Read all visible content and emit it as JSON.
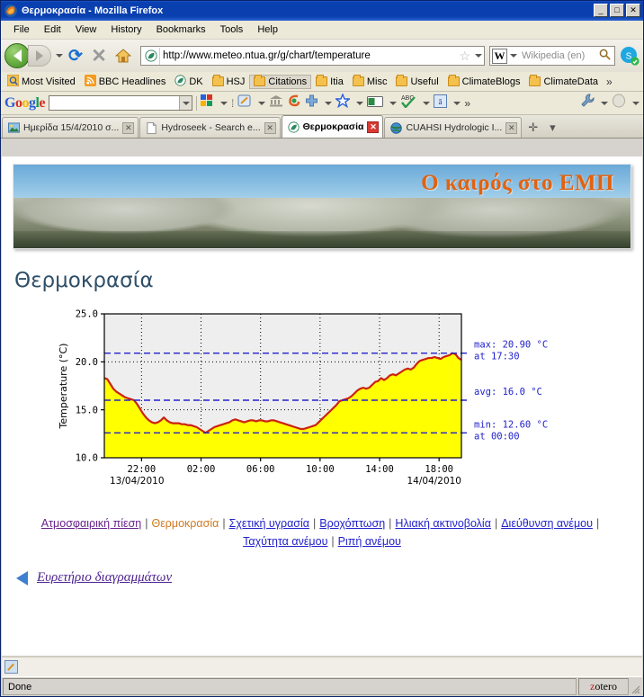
{
  "window": {
    "title": "Θερμοκρασία - Mozilla Firefox",
    "minimize_label": "_",
    "maximize_label": "□",
    "close_label": "✕"
  },
  "menubar": {
    "items": [
      {
        "label": "File"
      },
      {
        "label": "Edit"
      },
      {
        "label": "View"
      },
      {
        "label": "History"
      },
      {
        "label": "Bookmarks"
      },
      {
        "label": "Tools"
      },
      {
        "label": "Help"
      }
    ]
  },
  "navbar": {
    "back_title": "Back",
    "forward_title": "Forward",
    "reload_glyph": "⟳",
    "stop_glyph": "✕",
    "url": "http://www.meteo.ntua.gr/g/chart/temperature",
    "star_glyph": "☆",
    "search_engine": "Wikipedia (en)",
    "search_placeholder": "Wikipedia (en)",
    "search_logo": "W",
    "magnifier_glyph": "🔍"
  },
  "bookmarks": {
    "items": [
      {
        "label": "Most Visited",
        "icon": "globe-icon"
      },
      {
        "label": "BBC Headlines",
        "icon": "rss-icon"
      },
      {
        "label": "DK",
        "icon": "firefox-icon"
      },
      {
        "label": "HSJ",
        "icon": "folder-icon"
      },
      {
        "label": "Citations",
        "icon": "folder-icon"
      },
      {
        "label": "Itia",
        "icon": "folder-icon"
      },
      {
        "label": "Misc",
        "icon": "folder-icon"
      },
      {
        "label": "Useful",
        "icon": "folder-icon"
      },
      {
        "label": "ClimateBlogs",
        "icon": "folder-icon"
      },
      {
        "label": "ClimateData",
        "icon": "folder-icon"
      }
    ],
    "overflow_glyph": "»"
  },
  "google_toolbar": {
    "logo": "Google",
    "search_value": "",
    "overflow_glyph": "»",
    "icons": [
      "google-apps-icon",
      "divider-icon",
      "notes-icon",
      "bank-icon",
      "autolink-icon",
      "plus-icon",
      "bookmark-star-icon",
      "highlight-icon",
      "spellcheck-icon",
      "translate-icon",
      "more-icon",
      "wrench-icon",
      "account-icon"
    ]
  },
  "tabs": [
    {
      "label": "Ημερίδα 15/4/2010 σ...",
      "icon": "image-icon",
      "active": false,
      "close": "✕"
    },
    {
      "label": "Hydroseek - Search e...",
      "icon": "page-icon",
      "active": false,
      "close": "✕"
    },
    {
      "label": "Θερμοκρασία",
      "icon": "firefox-icon",
      "active": true,
      "close": "✕"
    },
    {
      "label": "CUAHSI Hydrologic I...",
      "icon": "globe-icon",
      "active": false,
      "close": "✕"
    }
  ],
  "newtab_glyph": "✛",
  "tablist_glyph": "▾",
  "page": {
    "banner_text": "Ο καιρός στο ΕΜΠ",
    "heading": "Θερμοκρασία",
    "links": [
      {
        "label": "Ατμοσφαιρική πίεση",
        "state": "visited"
      },
      {
        "label": "Θερμοκρασία",
        "state": "current"
      },
      {
        "label": "Σχετική υγρασία",
        "state": "link"
      },
      {
        "label": "Βροχόπτωση",
        "state": "link"
      },
      {
        "label": "Ηλιακή ακτινοβολία",
        "state": "link"
      },
      {
        "label": "Διεύθυνση ανέμου",
        "state": "link"
      },
      {
        "label": "Ταχύτητα ανέμου",
        "state": "link"
      },
      {
        "label": "Ριπή ανέμου",
        "state": "link"
      }
    ],
    "separator": "|",
    "index_link": "Ευρετήριο διαγραμμάτων"
  },
  "statusbar": {
    "status": "Done",
    "zotero_z": "z",
    "zotero_rest": "otero"
  },
  "chart_data": {
    "type": "area",
    "title": "",
    "xlabel": "",
    "ylabel": "Temperature (°C)",
    "ylim": [
      10.0,
      25.0
    ],
    "yticks": [
      "10.0",
      "15.0",
      "20.0",
      "25.0"
    ],
    "ytick_values": [
      10.0,
      15.0,
      20.0,
      25.0
    ],
    "xticks": [
      "22:00",
      "02:00",
      "06:00",
      "10:00",
      "14:00",
      "18:00"
    ],
    "xtick_hours": [
      22,
      26,
      30,
      34,
      38,
      42
    ],
    "x_start_hour": 19.5,
    "x_end_hour": 43.5,
    "date_left": "13/04/2010",
    "date_right": "14/04/2010",
    "grid": true,
    "fill_color": "#ffff00",
    "line_color": "#cc2211",
    "plot_bg": "#eeeeee",
    "annotation_color": "#2222cc",
    "annotations": [
      {
        "name": "max",
        "line_value": 20.9,
        "text": [
          "max: 20.90 °C",
          "at 17:30"
        ]
      },
      {
        "name": "avg",
        "line_value": 16.0,
        "text": [
          "avg: 16.0 °C"
        ]
      },
      {
        "name": "min",
        "line_value": 12.6,
        "text": [
          "min: 12.60 °C",
          "at 00:00"
        ]
      }
    ],
    "series": [
      {
        "name": "Temperature",
        "units": "°C",
        "x": [
          19.5,
          19.7,
          19.9,
          20.1,
          20.3,
          20.5,
          20.7,
          20.9,
          21.1,
          21.3,
          21.5,
          21.7,
          21.9,
          22.1,
          22.3,
          22.5,
          22.7,
          22.9,
          23.1,
          23.3,
          23.5,
          23.7,
          23.9,
          24.1,
          24.3,
          24.5,
          24.7,
          24.9,
          25.1,
          25.3,
          25.5,
          25.7,
          25.9,
          26.1,
          26.3,
          26.5,
          26.7,
          26.9,
          27.1,
          27.3,
          27.5,
          27.7,
          27.9,
          28.1,
          28.3,
          28.5,
          28.7,
          28.9,
          29.1,
          29.3,
          29.5,
          29.7,
          29.9,
          30.1,
          30.3,
          30.5,
          30.7,
          30.9,
          31.1,
          31.3,
          31.5,
          31.7,
          31.9,
          32.1,
          32.3,
          32.5,
          32.7,
          32.9,
          33.1,
          33.3,
          33.5,
          33.7,
          33.9,
          34.1,
          34.3,
          34.5,
          34.7,
          34.9,
          35.1,
          35.3,
          35.5,
          35.7,
          35.9,
          36.1,
          36.3,
          36.5,
          36.7,
          36.9,
          37.1,
          37.3,
          37.5,
          37.7,
          37.9,
          38.1,
          38.3,
          38.5,
          38.7,
          38.9,
          39.1,
          39.3,
          39.5,
          39.7,
          39.9,
          40.1,
          40.3,
          40.5,
          40.7,
          40.9,
          41.1,
          41.3,
          41.5,
          41.7,
          41.9,
          42.1,
          42.3,
          42.5,
          42.7,
          42.9,
          43.1,
          43.3,
          43.5
        ],
        "y": [
          18.3,
          18.2,
          17.7,
          17.2,
          16.9,
          16.7,
          16.5,
          16.3,
          16.2,
          16.1,
          16.0,
          15.6,
          15.1,
          14.6,
          14.2,
          13.9,
          13.7,
          13.6,
          13.7,
          13.9,
          14.2,
          13.9,
          13.7,
          13.6,
          13.6,
          13.6,
          13.5,
          13.5,
          13.4,
          13.4,
          13.3,
          13.2,
          13.0,
          12.8,
          12.6,
          12.8,
          13.0,
          13.2,
          13.3,
          13.4,
          13.5,
          13.6,
          13.7,
          13.9,
          14.0,
          13.9,
          13.8,
          13.7,
          13.8,
          13.9,
          13.9,
          13.8,
          13.9,
          13.9,
          13.8,
          13.8,
          13.9,
          13.9,
          13.8,
          13.7,
          13.6,
          13.5,
          13.4,
          13.3,
          13.2,
          13.1,
          13.0,
          13.0,
          13.1,
          13.2,
          13.3,
          13.4,
          13.7,
          14.0,
          14.3,
          14.6,
          14.9,
          15.2,
          15.5,
          15.9,
          16.0,
          16.1,
          16.2,
          16.4,
          16.7,
          17.0,
          17.2,
          17.3,
          17.2,
          17.3,
          17.6,
          17.9,
          18.0,
          18.3,
          18.1,
          18.3,
          18.6,
          18.7,
          18.6,
          18.8,
          19.0,
          19.2,
          19.3,
          19.2,
          19.4,
          19.8,
          20.1,
          20.2,
          20.3,
          20.4,
          20.4,
          20.5,
          20.4,
          20.3,
          20.5,
          20.6,
          20.7,
          20.9,
          20.8,
          20.4,
          20.2
        ]
      }
    ]
  }
}
